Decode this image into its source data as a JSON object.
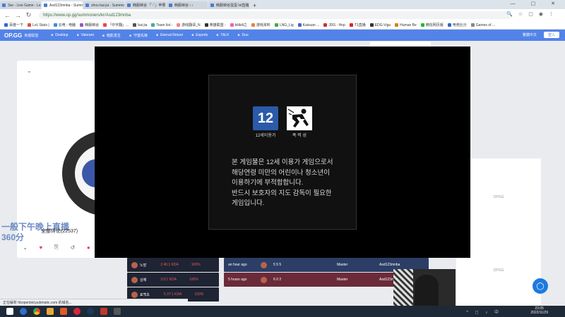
{
  "browser": {
    "tabs": [
      {
        "label": "3se - Live Game - League",
        "active": false
      },
      {
        "label": "Asd123mnba - Summoner",
        "active": true
      },
      {
        "label": "zhou bai jia - Summoner",
        "active": false
      },
      {
        "label": "韩服峡谷 「ˇ-ˇ」苹果",
        "active": false
      },
      {
        "label": "韩服峡谷 ‹ ›",
        "active": false
      },
      {
        "label": "韩服峡谷蛋蛋 lol直播_韩服",
        "active": false
      }
    ],
    "new_tab": "+",
    "url": "https://www.op.gg/summoners/kr/Asd123mnba",
    "bookmarks": [
      {
        "label": "百度一下",
        "color": "#2f68d8"
      },
      {
        "label": "LoL Stats |",
        "color": "#e0533d"
      },
      {
        "label": "云电 - 电脑",
        "color": "#3a8de0"
      },
      {
        "label": "韩服峡谷",
        "color": "#9a55c7"
      },
      {
        "label": "「中字翻」...",
        "color": "#e44"
      },
      {
        "label": "bai jia",
        "color": "#555"
      },
      {
        "label": "Team list -",
        "color": "#4aa"
      },
      {
        "label": "游戏翻译_N",
        "color": "#e88"
      },
      {
        "label": "英雄联盟 -",
        "color": "#333"
      },
      {
        "label": "bilibili之",
        "color": "#e6a"
      },
      {
        "label": "游戏资料",
        "color": "#d84"
      },
      {
        "label": "LNG_Lig",
        "color": "#4a4"
      },
      {
        "label": "Kaixuan ...",
        "color": "#46c"
      },
      {
        "label": "JDG - Hop",
        "color": "#c33"
      },
      {
        "label": "T1直播",
        "color": "#d22"
      },
      {
        "label": "EDG-Vigu",
        "color": "#333"
      },
      {
        "label": "Human Be",
        "color": "#c80"
      },
      {
        "label": "微信网页版",
        "color": "#2b2"
      },
      {
        "label": "电竞比分",
        "color": "#36c"
      },
      {
        "label": "Games of ...",
        "color": "#888"
      }
    ]
  },
  "opgg": {
    "logo": "OP.GG",
    "logo_sub": "英雄联盟",
    "nav": [
      "Desktop",
      "Valorant",
      "暗影发生",
      "守望先锋",
      "Eternal Return",
      "Esports",
      "TALK",
      "Duo"
    ],
    "language": "繁體中文",
    "login": "登入"
  },
  "notice": {
    "rating_label": "12세이용가",
    "rating_number": "12",
    "violence_label": "폭 력 성",
    "lines": [
      "본 게임물은 12세 이용가 게임으로서",
      "해당연령 미만의 어린이나 청소년이",
      "이용하기에 부적합합니다.",
      "반드시 보호자의 지도 감독이 필요한",
      "게임입니다."
    ]
  },
  "stream": {
    "title": "一般下午晚上直播",
    "time": "360分",
    "comments": "全部评论(22537)"
  },
  "matches": [
    {
      "player": "노발",
      "kda": "2.46:1 KDA",
      "pct": "100%",
      "time": "an hour ago",
      "score": "5 5 5",
      "tier": "Master",
      "name": "Asd123mnba",
      "color": "#2c3e66"
    },
    {
      "player": "김해",
      "kda": "3.0:1 KDA",
      "pct": "100%",
      "time": "5 hours ago",
      "score": "6 0 2",
      "tier": "Master",
      "name": "Asd123mnba",
      "color": "#6b2a3a"
    },
    {
      "player": "표백초",
      "kda": "5.37:1 KDA",
      "pct": "100%",
      "time": "",
      "score": "",
      "tier": "",
      "name": "",
      "color": "#2c3e66"
    }
  ],
  "right_cards": [
    "OPGG",
    "OPGG",
    "OPGG"
  ],
  "status_text": "正在解析 hbopenbid.pubmatic.com 的域名...",
  "clock": {
    "time": "23:05",
    "date": "2022/11/29"
  }
}
